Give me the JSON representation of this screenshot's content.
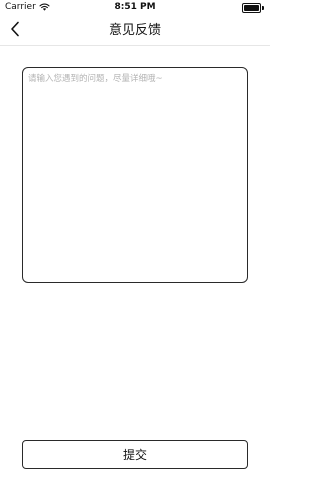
{
  "status_bar": {
    "carrier": "Carrier",
    "time": "8:51 PM",
    "wifi_icon": "wifi-icon",
    "battery_icon": "battery-icon",
    "battery_level": 1.0
  },
  "nav": {
    "title": "意见反馈",
    "back_icon": "chevron-left-icon"
  },
  "feedback": {
    "value": "",
    "placeholder": "请输入您遇到的问题，尽量详细哦~"
  },
  "actions": {
    "submit_label": "提交"
  }
}
